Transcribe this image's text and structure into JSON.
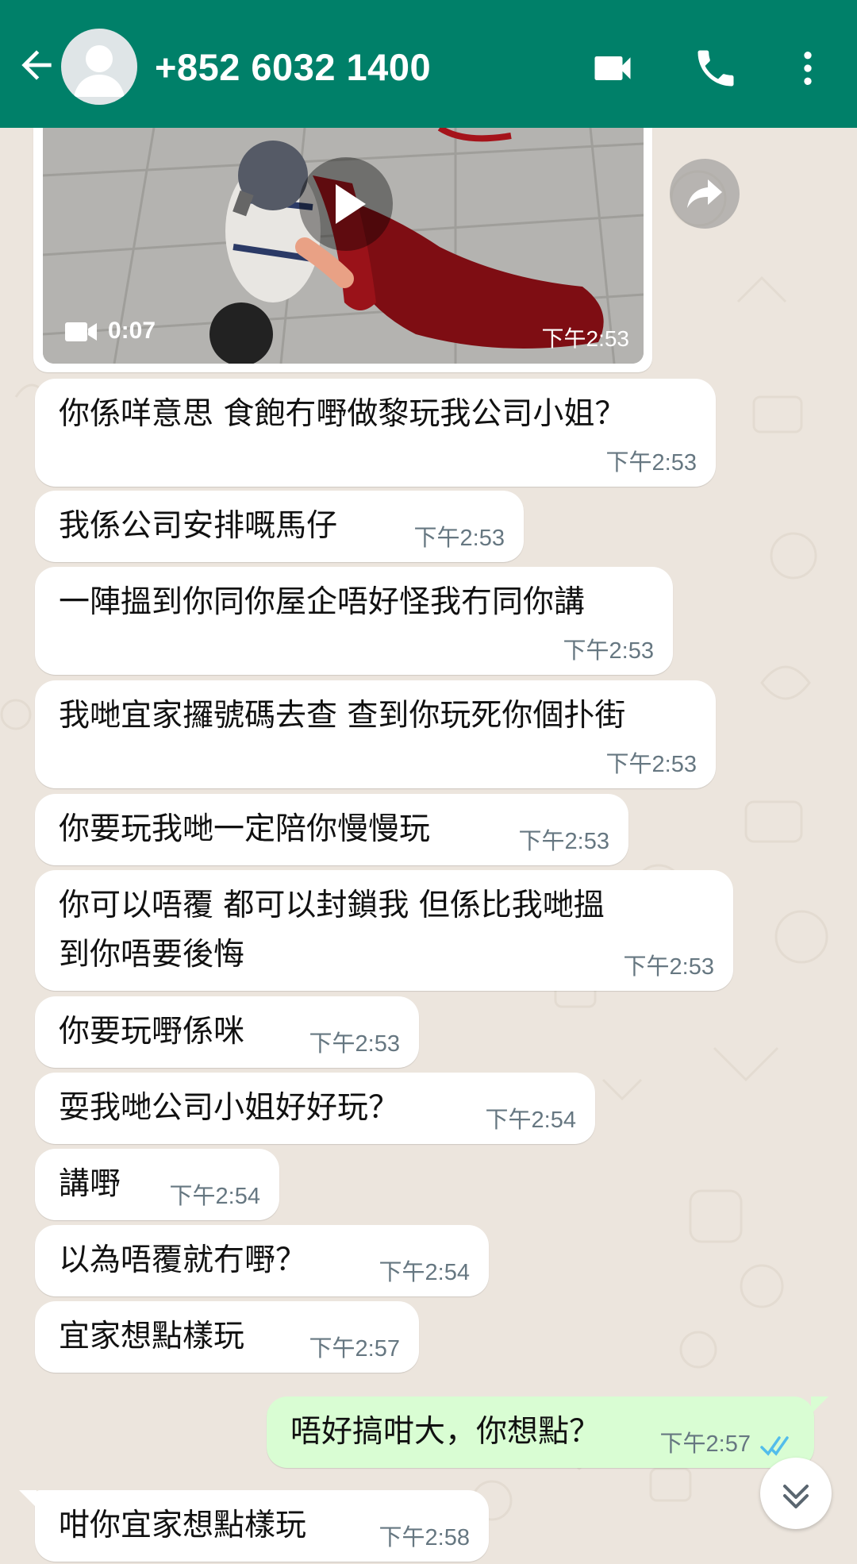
{
  "header": {
    "title": "+852 6032 1400",
    "bg_color": "#008069"
  },
  "media_message": {
    "duration": "0:07",
    "time": "下午2:53"
  },
  "messages": [
    {
      "text": "你係咩意思 食飽冇嘢做黎玩我公司小姐？",
      "time": "下午2:53",
      "direction": "incoming"
    },
    {
      "text": "我係公司安排嘅馬仔",
      "time": "下午2:53",
      "direction": "incoming"
    },
    {
      "text": "一陣搵到你同你屋企唔好怪我冇同你講",
      "time": "下午2:53",
      "direction": "incoming"
    },
    {
      "text": "我哋宜家攞號碼去查 查到你玩死你個扑街",
      "time": "下午2:53",
      "direction": "incoming"
    },
    {
      "text": "你要玩我哋一定陪你慢慢玩",
      "time": "下午2:53",
      "direction": "incoming"
    },
    {
      "text": "你可以唔覆 都可以封鎖我 但係比我哋搵到你唔要後悔",
      "time": "下午2:53",
      "direction": "incoming"
    },
    {
      "text": "你要玩嘢係咪",
      "time": "下午2:53",
      "direction": "incoming"
    },
    {
      "text": "耍我哋公司小姐好好玩？",
      "time": "下午2:54",
      "direction": "incoming"
    },
    {
      "text": "講嘢",
      "time": "下午2:54",
      "direction": "incoming"
    },
    {
      "text": "以為唔覆就冇嘢？",
      "time": "下午2:54",
      "direction": "incoming"
    },
    {
      "text": "宜家想點樣玩",
      "time": "下午2:57",
      "direction": "incoming"
    },
    {
      "text": "唔好搞咁大，你想點？",
      "time": "下午2:57",
      "direction": "outgoing",
      "status": "read"
    },
    {
      "text": "咁你宜家想點樣玩",
      "time": "下午2:58",
      "direction": "incoming"
    }
  ],
  "colors": {
    "incoming_bubble": "#ffffff",
    "outgoing_bubble": "#d9fdd3",
    "chat_bg": "#ece5dd",
    "read_ticks": "#53bdeb"
  },
  "icons": [
    "back-arrow-icon",
    "avatar-icon",
    "video-call-icon",
    "phone-icon",
    "more-vert-icon",
    "play-icon",
    "video-camera-icon",
    "forward-icon",
    "double-check-icon",
    "scroll-down-icon"
  ]
}
